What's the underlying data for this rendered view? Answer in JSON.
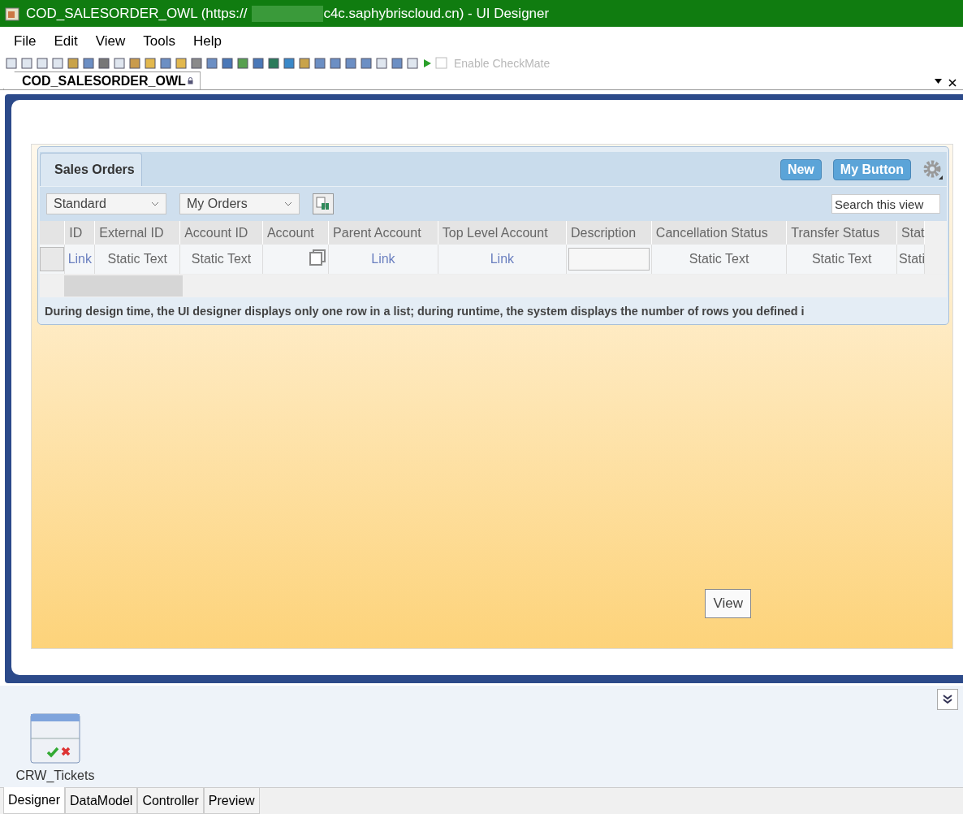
{
  "window": {
    "title_start": "COD_SALESORDER_OWL (https://",
    "title_end": "c4c.saphybriscloud.cn) - UI Designer"
  },
  "menu": [
    "File",
    "Edit",
    "View",
    "Tools",
    "Help"
  ],
  "toolbar": {
    "checkmate": {
      "label": "Enable CheckMate",
      "disabled": true
    }
  },
  "document_tab": {
    "label": "COD_SALESORDER_OWL",
    "locked": true
  },
  "panel": {
    "tabs": [
      {
        "label": "Sales Orders",
        "selected": true
      }
    ],
    "buttons": [
      "New",
      "My Button"
    ],
    "filters": [
      "Standard",
      "My Orders"
    ],
    "search": {
      "placeholder": "Search this view"
    },
    "table": {
      "columns": [
        "ID",
        "External ID",
        "Account ID",
        "Account",
        "Parent Account",
        "Top Level Account",
        "Description",
        "Cancellation Status",
        "Transfer Status",
        "Stat"
      ],
      "row": [
        {
          "kind": "link",
          "text": "Link"
        },
        {
          "kind": "text",
          "text": "Static Text"
        },
        {
          "kind": "text",
          "text": "Static Text"
        },
        {
          "kind": "icon"
        },
        {
          "kind": "link",
          "text": "Link"
        },
        {
          "kind": "link",
          "text": "Link"
        },
        {
          "kind": "input"
        },
        {
          "kind": "text",
          "text": "Static Text"
        },
        {
          "kind": "text",
          "text": "Static Text"
        },
        {
          "kind": "text",
          "text": "Stati"
        }
      ]
    },
    "note": "During design time, the UI designer displays only one row in a list; during runtime, the system displays the number of rows you defined i"
  },
  "view_button": "View",
  "components": [
    {
      "label": "CRW_Tickets"
    }
  ],
  "bottom_tabs": [
    {
      "label": "Designer",
      "selected": true
    },
    {
      "label": "DataModel",
      "selected": false
    },
    {
      "label": "Controller",
      "selected": false
    },
    {
      "label": "Preview",
      "selected": false
    }
  ]
}
